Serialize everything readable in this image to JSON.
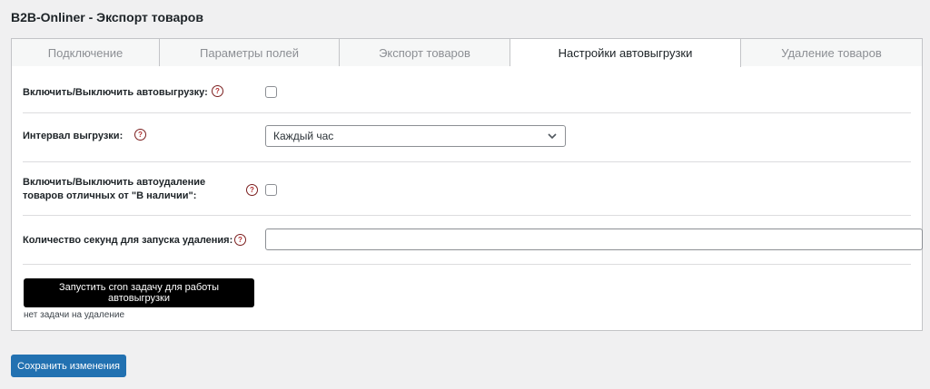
{
  "page": {
    "title": "B2B-Onliner - Экспорт товаров"
  },
  "tabs": [
    {
      "label": "Подключение",
      "active": false
    },
    {
      "label": "Параметры полей",
      "active": false
    },
    {
      "label": "Экспорт товаров",
      "active": false
    },
    {
      "label": "Настройки автовыгрузки",
      "active": true
    },
    {
      "label": "Удаление товаров",
      "active": false
    }
  ],
  "form": {
    "autoexport": {
      "label": "Включить/Выключить автовыгрузку:",
      "checked": false,
      "help": "?"
    },
    "interval": {
      "label": "Интервал выгрузки:",
      "value": "Каждый час",
      "help": "?"
    },
    "autodelete": {
      "label_line1": "Включить/Выключить автоудаление",
      "label_line2": "товаров отличных от \"В наличии\":",
      "checked": false,
      "help": "?"
    },
    "delete_seconds": {
      "label": "Количество секунд для запуска удаления:",
      "value": "",
      "help": "?"
    }
  },
  "cron": {
    "button_label": "Запустить cron задачу для работы автовыгрузки",
    "status": "нет задачи на удаление"
  },
  "footer": {
    "save_label": "Сохранить изменения"
  },
  "colors": {
    "primary": "#2271b1",
    "help_icon": "#b32d2e",
    "cron_button": "#000000"
  }
}
